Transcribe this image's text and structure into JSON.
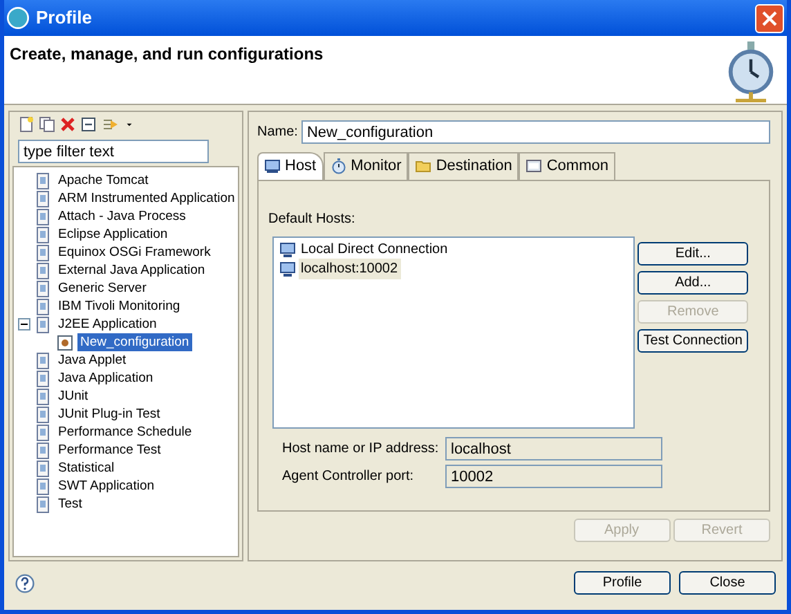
{
  "window": {
    "title": "Profile"
  },
  "header": {
    "text": "Create, manage, and run configurations"
  },
  "filter": {
    "placeholder": "type filter text"
  },
  "tree": [
    {
      "label": "Apache Tomcat",
      "selected": false
    },
    {
      "label": "ARM Instrumented Application",
      "selected": false
    },
    {
      "label": "Attach - Java Process",
      "selected": false
    },
    {
      "label": "Eclipse Application",
      "selected": false
    },
    {
      "label": "Equinox OSGi Framework",
      "selected": false
    },
    {
      "label": "External Java Application",
      "selected": false
    },
    {
      "label": "Generic Server",
      "selected": false
    },
    {
      "label": "IBM Tivoli Monitoring",
      "selected": false
    },
    {
      "label": "J2EE Application",
      "selected": false,
      "expanded": true,
      "children": [
        {
          "label": "New_configuration",
          "selected": true
        }
      ]
    },
    {
      "label": "Java Applet",
      "selected": false
    },
    {
      "label": "Java Application",
      "selected": false
    },
    {
      "label": "JUnit",
      "selected": false
    },
    {
      "label": "JUnit Plug-in Test",
      "selected": false
    },
    {
      "label": "Performance Schedule",
      "selected": false
    },
    {
      "label": "Performance Test",
      "selected": false
    },
    {
      "label": "Statistical",
      "selected": false
    },
    {
      "label": "SWT Application",
      "selected": false
    },
    {
      "label": "Test",
      "selected": false
    }
  ],
  "name_field": {
    "label": "Name:",
    "value": "New_configuration"
  },
  "tabs": [
    {
      "label": "Host",
      "selected": true
    },
    {
      "label": "Monitor",
      "selected": false
    },
    {
      "label": "Destination",
      "selected": false
    },
    {
      "label": "Common",
      "selected": false
    }
  ],
  "hosts": {
    "label": "Default Hosts:",
    "items": [
      {
        "label": "Local Direct Connection",
        "selected": false
      },
      {
        "label": "localhost:10002",
        "selected": true
      }
    ]
  },
  "host_buttons": [
    {
      "label": "Edit...",
      "disabled": false
    },
    {
      "label": "Add...",
      "disabled": false
    },
    {
      "label": "Remove",
      "disabled": true
    },
    {
      "label": "Test Connection",
      "disabled": false
    }
  ],
  "fields": [
    {
      "label": "Host name or IP address:",
      "value": "localhost"
    },
    {
      "label": "Agent Controller port:",
      "value": "10002"
    }
  ],
  "apply_buttons": [
    {
      "label": "Apply",
      "disabled": true
    },
    {
      "label": "Revert",
      "disabled": true
    }
  ],
  "footer_buttons": [
    {
      "label": "Profile",
      "disabled": false
    },
    {
      "label": "Close",
      "disabled": false
    }
  ]
}
